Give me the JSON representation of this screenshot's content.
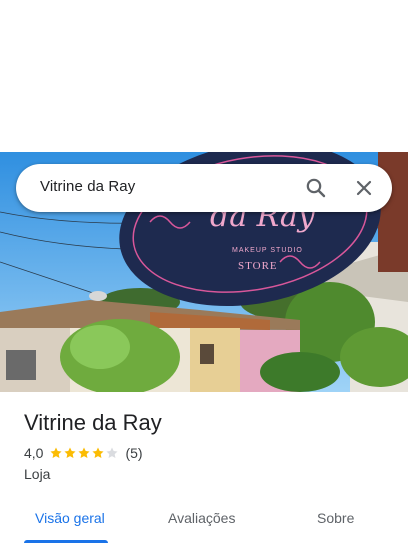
{
  "search": {
    "query": "Vitrine da Ray"
  },
  "photo": {
    "sign_script": "da Ray",
    "sign_line1": "MAKEUP STUDIO",
    "sign_line2": "STORE"
  },
  "place": {
    "name": "Vitrine da Ray",
    "rating": "4,0",
    "stars_filled": 4,
    "stars_total": 5,
    "review_count": "(5)",
    "category": "Loja"
  },
  "tabs": [
    {
      "label": "Visão geral",
      "active": true
    },
    {
      "label": "Avaliações",
      "active": false
    },
    {
      "label": "Sobre",
      "active": false
    }
  ],
  "colors": {
    "accent": "#1a73e8",
    "star": "#fbbc04",
    "star_empty": "#dadce0",
    "sign": "#1e2a4f",
    "sign_ornament": "#d8579a"
  },
  "icons": {
    "search": "search-icon",
    "close": "close-icon"
  }
}
